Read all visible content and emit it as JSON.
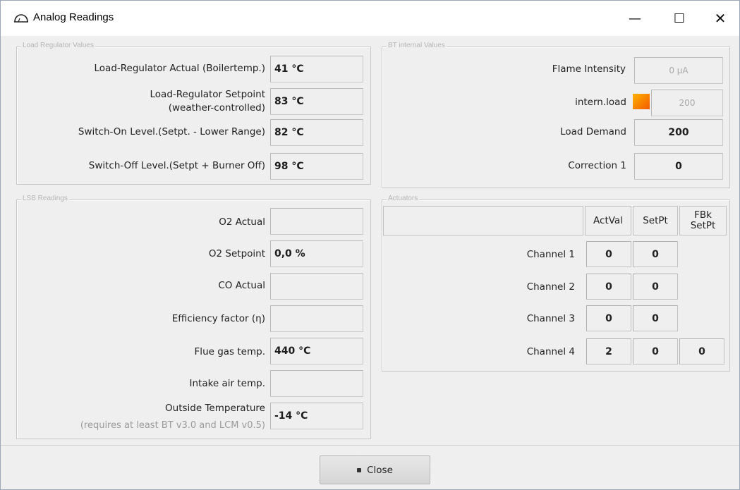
{
  "window": {
    "title": "Analog Readings",
    "icon": "burner-dome-icon",
    "minimize_glyph": "—",
    "maximize_glyph": "☐",
    "close_glyph": "✕"
  },
  "load_regulator": {
    "legend": "Load Regulator Values",
    "rows": [
      {
        "label": "Load-Regulator Actual (Boilertemp.)",
        "value": "41 °C"
      },
      {
        "label": "Load-Regulator Setpoint",
        "label2": "(weather-controlled)",
        "value": "83 °C"
      },
      {
        "label": "Switch-On Level.(Setpt. - Lower Range)",
        "value": "82 °C"
      },
      {
        "label": "Switch-Off Level.(Setpt + Burner Off)",
        "value": "98 °C"
      }
    ]
  },
  "bt_internal": {
    "legend": "BT internal Values",
    "flame_intensity": {
      "label": "Flame Intensity",
      "value": "0 µA"
    },
    "intern_load": {
      "label": "intern.load",
      "value": "200",
      "swatch_color": "#f36a00"
    },
    "load_demand": {
      "label": "Load Demand",
      "value": "200"
    },
    "correction": {
      "label": "Correction 1",
      "value": "0"
    }
  },
  "lsb": {
    "legend": "LSB Readings",
    "rows": [
      {
        "label": "O2 Actual",
        "value": ""
      },
      {
        "label": "O2 Setpoint",
        "value": "0,0 %"
      },
      {
        "label": "CO Actual",
        "value": ""
      },
      {
        "label": "Efficiency factor (η)",
        "value": ""
      },
      {
        "label": "Flue gas temp.",
        "value": "440 °C"
      },
      {
        "label": "Intake air temp.",
        "value": ""
      }
    ],
    "outside": {
      "label": "Outside Temperature",
      "hint": "(requires at least BT v3.0 and LCM v0.5)",
      "value": "-14 °C"
    }
  },
  "actuators": {
    "legend": "Actuators",
    "headers": [
      "ActVal",
      "SetPt",
      "FBk",
      "SetPt"
    ],
    "channels": [
      {
        "label": "Channel 1",
        "actval": "0",
        "setpt": "0",
        "fbk": ""
      },
      {
        "label": "Channel 2",
        "actval": "0",
        "setpt": "0",
        "fbk": ""
      },
      {
        "label": "Channel 3",
        "actval": "0",
        "setpt": "0",
        "fbk": ""
      },
      {
        "label": "Channel 4",
        "actval": "2",
        "setpt": "0",
        "fbk": "0"
      }
    ]
  },
  "footer": {
    "close_label": "Close"
  }
}
